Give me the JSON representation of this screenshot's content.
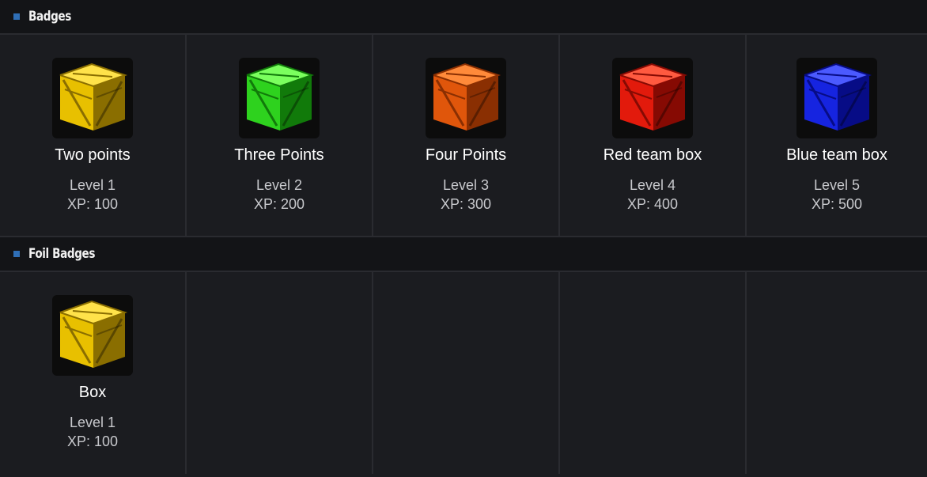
{
  "sections": [
    {
      "title": "Badges",
      "badges": [
        {
          "name": "Two points",
          "level": "Level 1",
          "xp": "XP: 100",
          "color": "#e8c000",
          "dark": "#8a6e00",
          "light": "#ffe24a",
          "icon": "yellow-crate-icon"
        },
        {
          "name": "Three Points",
          "level": "Level 2",
          "xp": "XP: 200",
          "color": "#2ed21e",
          "dark": "#117a0a",
          "light": "#7bff5e",
          "icon": "green-crate-icon"
        },
        {
          "name": "Four Points",
          "level": "Level 3",
          "xp": "XP: 300",
          "color": "#e0560b",
          "dark": "#8a2f02",
          "light": "#ff8a3a",
          "icon": "orange-crate-icon"
        },
        {
          "name": "Red team box",
          "level": "Level 4",
          "xp": "XP: 400",
          "color": "#e21a0c",
          "dark": "#860a03",
          "light": "#ff5a40",
          "icon": "red-crate-icon"
        },
        {
          "name": "Blue team box",
          "level": "Level 5",
          "xp": "XP: 500",
          "color": "#1624e0",
          "dark": "#070c86",
          "light": "#4b5aff",
          "icon": "blue-crate-icon"
        }
      ]
    },
    {
      "title": "Foil Badges",
      "badges": [
        {
          "name": "Box",
          "level": "Level 1",
          "xp": "XP: 100",
          "color": "#e8c000",
          "dark": "#8a6e00",
          "light": "#ffe24a",
          "icon": "yellow-crate-icon"
        }
      ]
    }
  ]
}
